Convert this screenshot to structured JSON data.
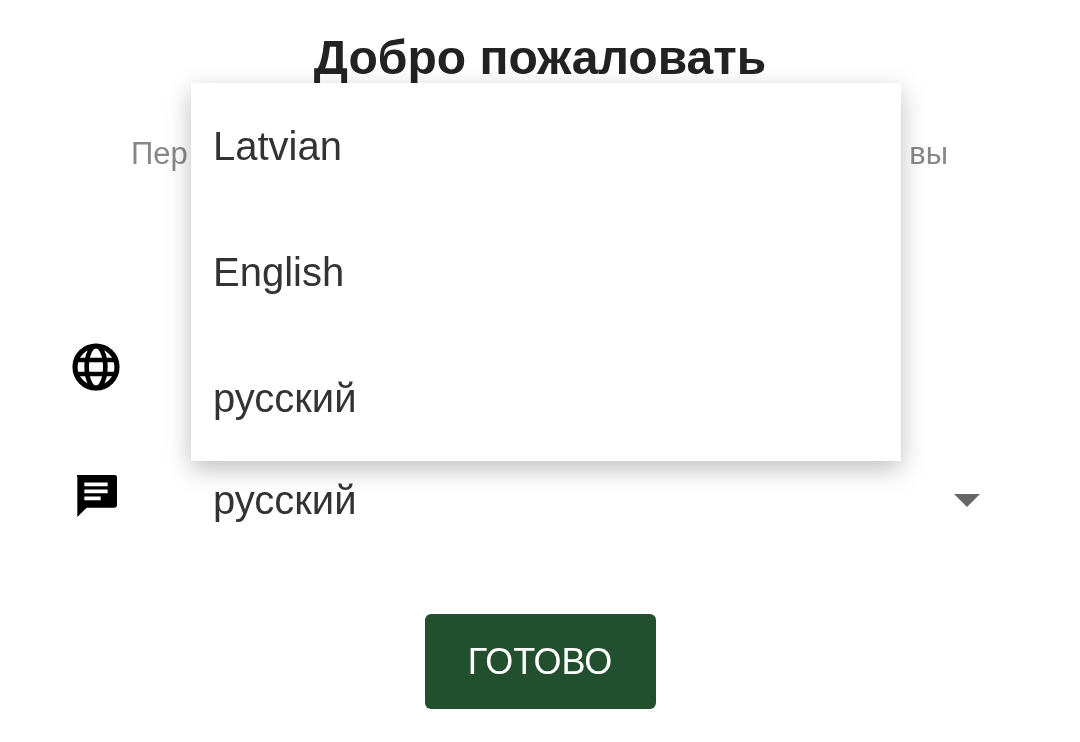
{
  "title": "Добро пожаловать",
  "subtitle": {
    "left_part": "Пер",
    "right_part": "вы"
  },
  "fields": [
    {
      "kind": "language_site"
    },
    {
      "kind": "language_content",
      "value": "русский"
    }
  ],
  "menu": {
    "items": [
      {
        "label": "Latvian"
      },
      {
        "label": "English"
      },
      {
        "label": "русский"
      }
    ]
  },
  "button": "ГОТОВО"
}
